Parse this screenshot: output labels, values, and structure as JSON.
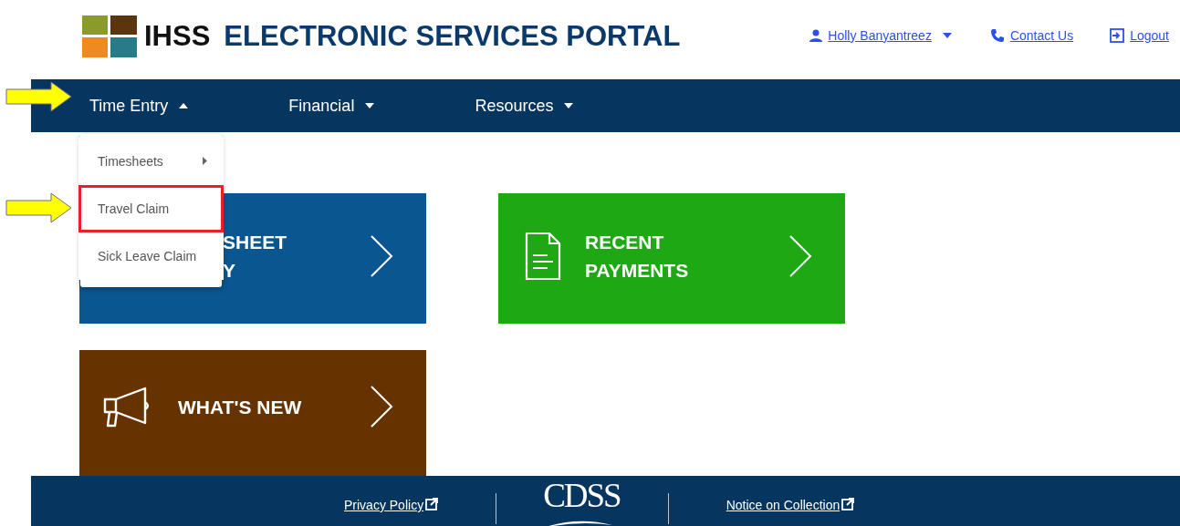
{
  "header": {
    "brand": "IHSS",
    "title": "ELECTRONIC SERVICES PORTAL",
    "user": "Holly Banyantreez",
    "contact": "Contact Us",
    "logout": "Logout"
  },
  "nav": {
    "items": [
      {
        "label": "Time Entry",
        "expanded": true,
        "menu": [
          {
            "label": "Timesheets",
            "submenu": true,
            "highlighted": false
          },
          {
            "label": "Travel Claim",
            "submenu": false,
            "highlighted": true
          },
          {
            "label": "Sick Leave Claim",
            "submenu": false,
            "highlighted": false
          }
        ]
      },
      {
        "label": "Financial",
        "expanded": false
      },
      {
        "label": "Resources",
        "expanded": false
      }
    ]
  },
  "tiles": [
    {
      "kind": "timesheet",
      "color": "#0a5690",
      "lines": [
        "SHEET",
        "Y"
      ]
    },
    {
      "kind": "payments",
      "color": "#1ea814",
      "lines": [
        "RECENT",
        "PAYMENTS"
      ]
    },
    {
      "kind": "news",
      "color": "#663300",
      "lines": [
        "WHAT'S NEW"
      ]
    }
  ],
  "footer": {
    "privacy": "Privacy Policy",
    "logo": "CDSS",
    "notice": "Notice on Collection"
  }
}
